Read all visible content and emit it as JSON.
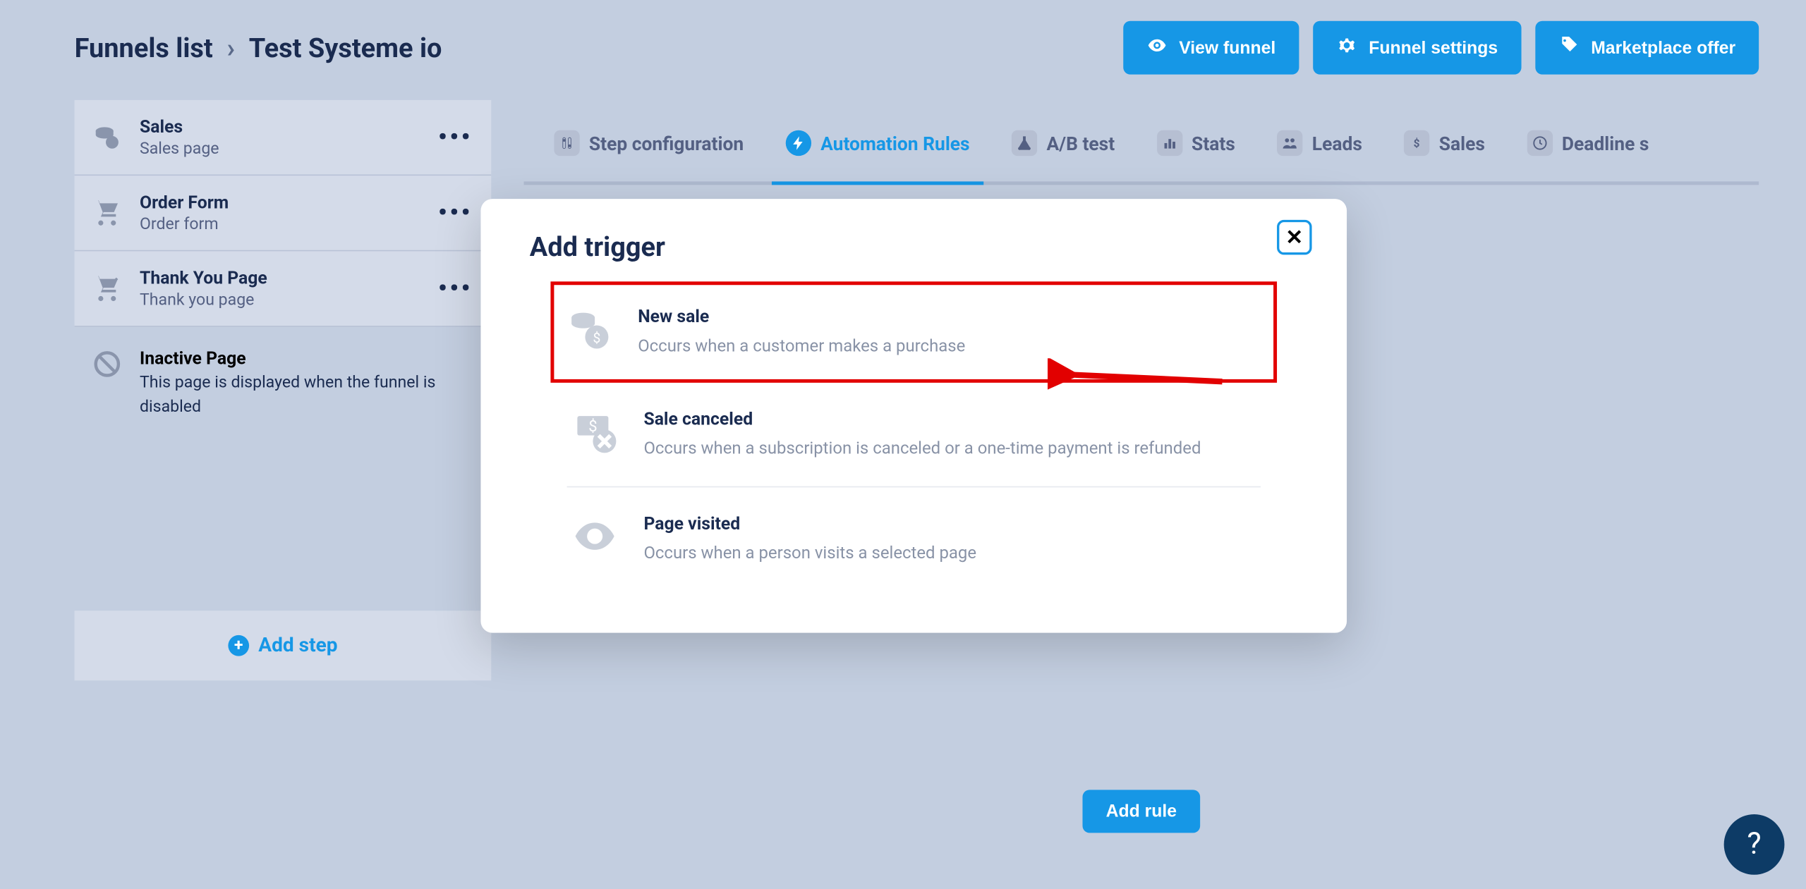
{
  "breadcrumb": {
    "root": "Funnels list",
    "current": "Test Systeme io"
  },
  "header_buttons": {
    "view": "View funnel",
    "settings": "Funnel settings",
    "marketplace": "Marketplace offer"
  },
  "sidebar": {
    "steps": [
      {
        "title": "Sales",
        "sub": "Sales page"
      },
      {
        "title": "Order Form",
        "sub": "Order form"
      },
      {
        "title": "Thank You Page",
        "sub": "Thank you page"
      }
    ],
    "inactive": {
      "title": "Inactive Page",
      "desc": "This page is displayed when the funnel is disabled"
    },
    "add_step": "Add step"
  },
  "tabs": [
    {
      "label": "Step configuration"
    },
    {
      "label": "Automation Rules"
    },
    {
      "label": "A/B test"
    },
    {
      "label": "Stats"
    },
    {
      "label": "Leads"
    },
    {
      "label": "Sales"
    },
    {
      "label": "Deadline s"
    }
  ],
  "add_rule": "Add rule",
  "modal": {
    "title": "Add trigger",
    "triggers": [
      {
        "title": "New sale",
        "desc": "Occurs when a customer makes a purchase"
      },
      {
        "title": "Sale canceled",
        "desc": "Occurs when a subscription is canceled or a one-time payment is refunded"
      },
      {
        "title": "Page visited",
        "desc": "Occurs when a person visits a selected page"
      }
    ]
  },
  "help": "?"
}
